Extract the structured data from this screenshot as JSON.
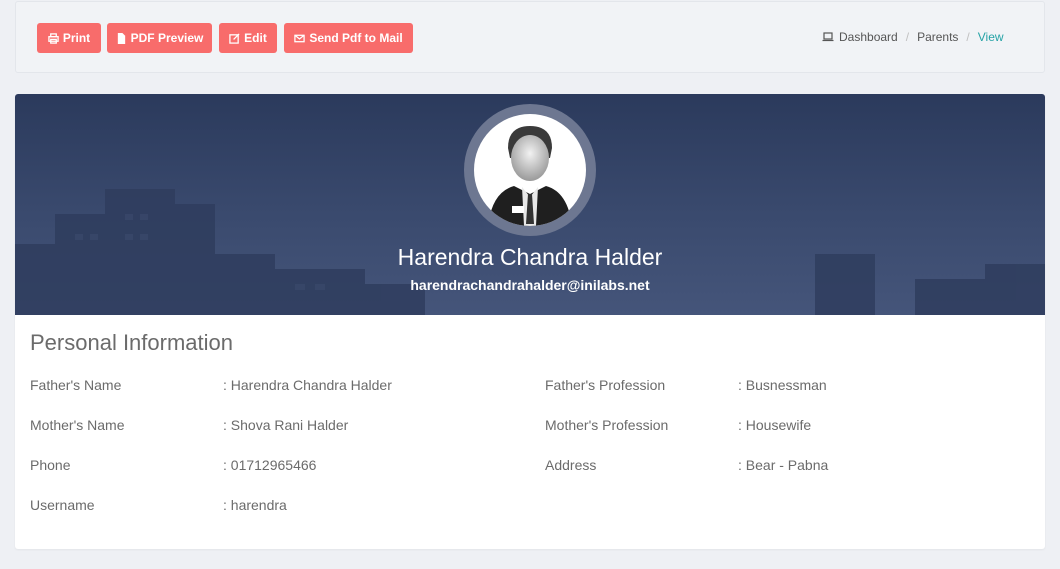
{
  "toolbar": {
    "buttons": [
      {
        "label": "Print",
        "icon": "printer-icon"
      },
      {
        "label": "PDF Preview",
        "icon": "file-icon"
      },
      {
        "label": "Edit",
        "icon": "edit-icon"
      },
      {
        "label": "Send Pdf to Mail",
        "icon": "envelope-icon"
      }
    ],
    "button_color": "#f86c6b"
  },
  "breadcrumb": {
    "items": [
      "Dashboard",
      "Parents",
      "View"
    ],
    "icon": "laptop-icon",
    "active_color": "#26a3a6"
  },
  "profile": {
    "name": "Harendra Chandra Halder",
    "email": "harendrachandrahalder@inilabs.net"
  },
  "personal_info": {
    "title": "Personal Information",
    "left": [
      {
        "label": "Father's Name",
        "value": ": Harendra Chandra Halder"
      },
      {
        "label": "Mother's Name",
        "value": ": Shova Rani Halder"
      },
      {
        "label": "Phone",
        "value": ": 01712965466"
      },
      {
        "label": "Username",
        "value": ": harendra"
      }
    ],
    "right": [
      {
        "label": "Father's Profession",
        "value": ": Busnessman"
      },
      {
        "label": "Mother's Profession",
        "value": ": Housewife"
      },
      {
        "label": "Address",
        "value": ": Bear - Pabna"
      }
    ]
  }
}
